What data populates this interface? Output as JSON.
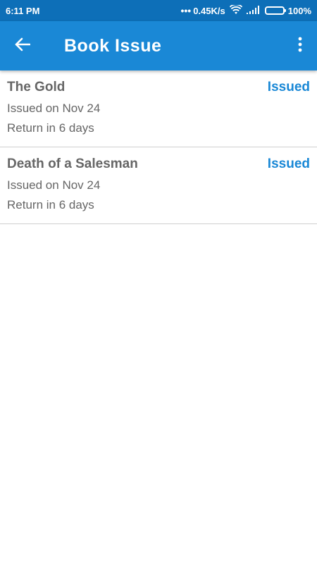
{
  "status_bar": {
    "time": "6:11 PM",
    "network_speed": "0.45K/s",
    "battery": "100%",
    "icons": [
      "wifi-icon",
      "signal-icon",
      "battery-icon"
    ]
  },
  "app_bar": {
    "title": "Book Issue",
    "back_icon": "arrow-back-icon",
    "menu_icon": "more-vertical-icon",
    "color": "#1a88d6"
  },
  "books": [
    {
      "title": "The Gold",
      "status": "Issued",
      "issued_on": "Issued on Nov 24",
      "return_in": "Return in 6 days"
    },
    {
      "title": "Death of a Salesman",
      "status": "Issued",
      "issued_on": "Issued on Nov 24",
      "return_in": "Return in 6 days"
    }
  ]
}
